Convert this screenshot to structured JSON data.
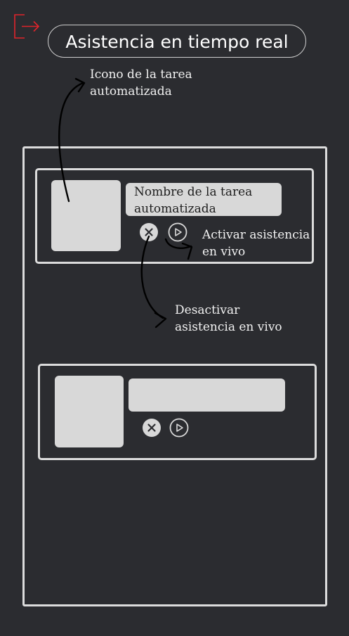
{
  "header": {
    "title": "Asistencia en tiempo real",
    "logout_icon": "logout-icon",
    "accent_color": "#e0242b"
  },
  "annotations": {
    "task_icon": [
      "Icono de la tarea",
      "automatizada"
    ],
    "activate": [
      "Activar asistencia",
      "en vivo"
    ],
    "deactivate": [
      "Desactivar",
      "asistencia en vivo"
    ]
  },
  "tasks": [
    {
      "name_lines": [
        "Nombre de la tarea",
        "automatizada"
      ],
      "thumbnail_icon": "task-thumbnail",
      "controls": [
        "close-icon",
        "play-icon"
      ]
    },
    {
      "name_lines": [
        "",
        ""
      ],
      "thumbnail_icon": "task-thumbnail",
      "controls": [
        "close-icon",
        "play-icon"
      ]
    }
  ]
}
